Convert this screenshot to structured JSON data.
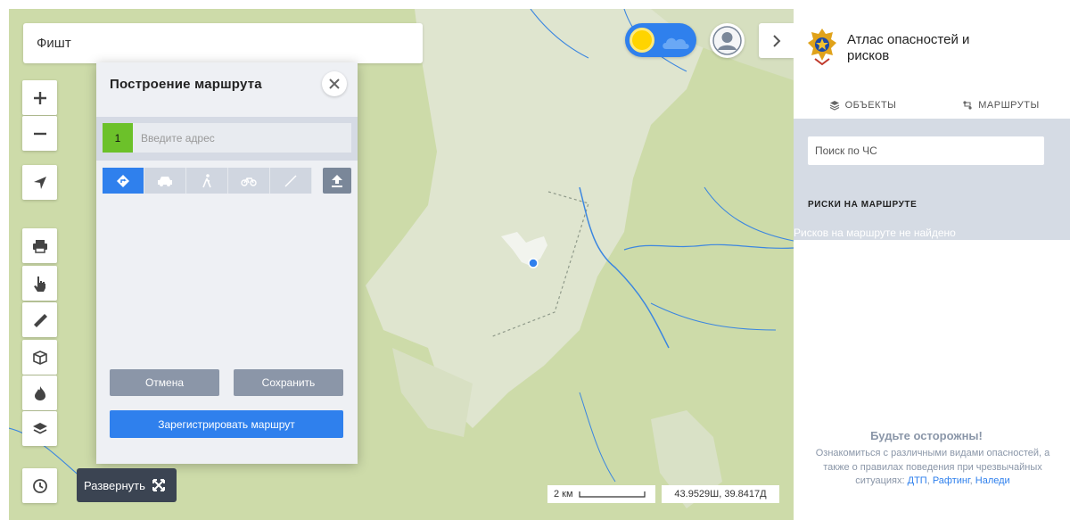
{
  "map": {
    "search_value": "Фишт",
    "colors": {
      "terrain": "#cddba9",
      "mountain": "#dfe5cf",
      "river": "#3b86e0",
      "accent": "#2f80ed"
    },
    "scale_label": "2 км",
    "coords": "43.9529Ш, 39.8417Д",
    "expand_label": "Развернуть",
    "controls": [
      "zoom-in-icon",
      "zoom-out-icon",
      "locate-icon",
      "print-icon",
      "pointer-icon",
      "ruler-icon",
      "3d-box-icon",
      "fire-icon",
      "layers-icon",
      "history-icon"
    ]
  },
  "route_dialog": {
    "title": "Построение маршрута",
    "point_number": "1",
    "address_placeholder": "Введите адрес",
    "modes": [
      "route-icon",
      "car-icon",
      "walk-icon",
      "bike-icon",
      "line-icon"
    ],
    "cancel_label": "Отмена",
    "save_label": "Сохранить",
    "register_label": "Зарегистрировать маршрут"
  },
  "panel": {
    "title": "Атлас опасностей и рисков",
    "tabs": [
      {
        "label": "ОБЪЕКТЫ",
        "icon": "layers-icon"
      },
      {
        "label": "МАРШРУТЫ",
        "icon": "route-icon"
      }
    ],
    "search_placeholder": "Поиск по ЧС",
    "risk_heading": "РИСКИ НА МАРШРУТЕ",
    "risk_none": "Рисков на маршруте не найдено",
    "caution_title": "Будьте осторожны!",
    "caution_text": "Ознакомиться с различными видами опасностей, а также о правилах поведения при чрезвычайных ситуациях:",
    "links": [
      "ДТП",
      "Рафтинг",
      "Наледи"
    ]
  }
}
